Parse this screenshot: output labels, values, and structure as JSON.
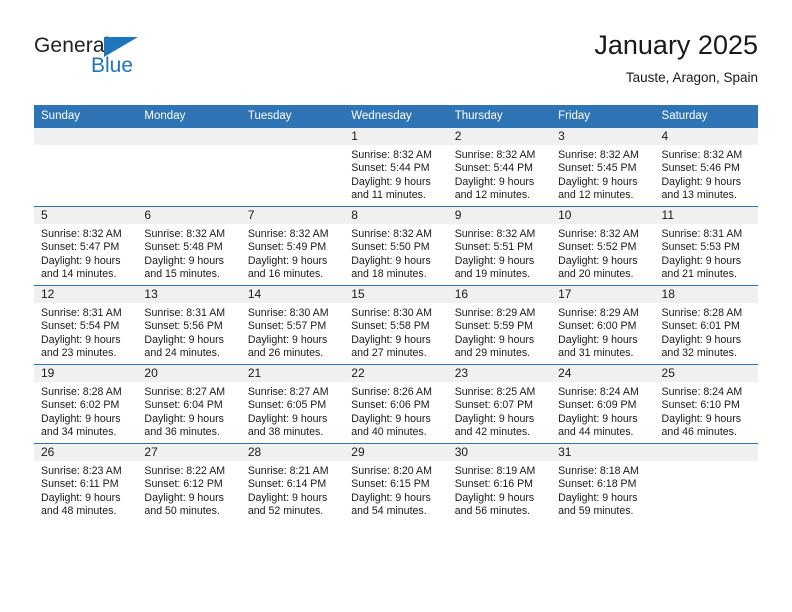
{
  "brand": {
    "line1": "General",
    "line2": "Blue",
    "triangle_color": "#1f76bc",
    "text_color": "#231f20"
  },
  "header": {
    "title": "January 2025",
    "subtitle": "Tauste, Aragon, Spain"
  },
  "theme": {
    "header_row_bg": "#2f74b5",
    "header_row_text": "#ffffff",
    "daynum_bg": "#f0f0f0",
    "grid_line": "#2f74b5",
    "cell_bg": "#ffffff"
  },
  "calendar": {
    "weekday_headers": [
      "Sunday",
      "Monday",
      "Tuesday",
      "Wednesday",
      "Thursday",
      "Friday",
      "Saturday"
    ],
    "weeks": [
      [
        {
          "day": "",
          "blank": true,
          "sunrise": "",
          "sunset": "",
          "daylight_line1": "",
          "daylight_line2": ""
        },
        {
          "day": "",
          "blank": true,
          "sunrise": "",
          "sunset": "",
          "daylight_line1": "",
          "daylight_line2": ""
        },
        {
          "day": "",
          "blank": true,
          "sunrise": "",
          "sunset": "",
          "daylight_line1": "",
          "daylight_line2": ""
        },
        {
          "day": "1",
          "blank": false,
          "sunrise": "Sunrise: 8:32 AM",
          "sunset": "Sunset: 5:44 PM",
          "daylight_line1": "Daylight: 9 hours",
          "daylight_line2": "and 11 minutes."
        },
        {
          "day": "2",
          "blank": false,
          "sunrise": "Sunrise: 8:32 AM",
          "sunset": "Sunset: 5:44 PM",
          "daylight_line1": "Daylight: 9 hours",
          "daylight_line2": "and 12 minutes."
        },
        {
          "day": "3",
          "blank": false,
          "sunrise": "Sunrise: 8:32 AM",
          "sunset": "Sunset: 5:45 PM",
          "daylight_line1": "Daylight: 9 hours",
          "daylight_line2": "and 12 minutes."
        },
        {
          "day": "4",
          "blank": false,
          "sunrise": "Sunrise: 8:32 AM",
          "sunset": "Sunset: 5:46 PM",
          "daylight_line1": "Daylight: 9 hours",
          "daylight_line2": "and 13 minutes."
        }
      ],
      [
        {
          "day": "5",
          "blank": false,
          "sunrise": "Sunrise: 8:32 AM",
          "sunset": "Sunset: 5:47 PM",
          "daylight_line1": "Daylight: 9 hours",
          "daylight_line2": "and 14 minutes."
        },
        {
          "day": "6",
          "blank": false,
          "sunrise": "Sunrise: 8:32 AM",
          "sunset": "Sunset: 5:48 PM",
          "daylight_line1": "Daylight: 9 hours",
          "daylight_line2": "and 15 minutes."
        },
        {
          "day": "7",
          "blank": false,
          "sunrise": "Sunrise: 8:32 AM",
          "sunset": "Sunset: 5:49 PM",
          "daylight_line1": "Daylight: 9 hours",
          "daylight_line2": "and 16 minutes."
        },
        {
          "day": "8",
          "blank": false,
          "sunrise": "Sunrise: 8:32 AM",
          "sunset": "Sunset: 5:50 PM",
          "daylight_line1": "Daylight: 9 hours",
          "daylight_line2": "and 18 minutes."
        },
        {
          "day": "9",
          "blank": false,
          "sunrise": "Sunrise: 8:32 AM",
          "sunset": "Sunset: 5:51 PM",
          "daylight_line1": "Daylight: 9 hours",
          "daylight_line2": "and 19 minutes."
        },
        {
          "day": "10",
          "blank": false,
          "sunrise": "Sunrise: 8:32 AM",
          "sunset": "Sunset: 5:52 PM",
          "daylight_line1": "Daylight: 9 hours",
          "daylight_line2": "and 20 minutes."
        },
        {
          "day": "11",
          "blank": false,
          "sunrise": "Sunrise: 8:31 AM",
          "sunset": "Sunset: 5:53 PM",
          "daylight_line1": "Daylight: 9 hours",
          "daylight_line2": "and 21 minutes."
        }
      ],
      [
        {
          "day": "12",
          "blank": false,
          "sunrise": "Sunrise: 8:31 AM",
          "sunset": "Sunset: 5:54 PM",
          "daylight_line1": "Daylight: 9 hours",
          "daylight_line2": "and 23 minutes."
        },
        {
          "day": "13",
          "blank": false,
          "sunrise": "Sunrise: 8:31 AM",
          "sunset": "Sunset: 5:56 PM",
          "daylight_line1": "Daylight: 9 hours",
          "daylight_line2": "and 24 minutes."
        },
        {
          "day": "14",
          "blank": false,
          "sunrise": "Sunrise: 8:30 AM",
          "sunset": "Sunset: 5:57 PM",
          "daylight_line1": "Daylight: 9 hours",
          "daylight_line2": "and 26 minutes."
        },
        {
          "day": "15",
          "blank": false,
          "sunrise": "Sunrise: 8:30 AM",
          "sunset": "Sunset: 5:58 PM",
          "daylight_line1": "Daylight: 9 hours",
          "daylight_line2": "and 27 minutes."
        },
        {
          "day": "16",
          "blank": false,
          "sunrise": "Sunrise: 8:29 AM",
          "sunset": "Sunset: 5:59 PM",
          "daylight_line1": "Daylight: 9 hours",
          "daylight_line2": "and 29 minutes."
        },
        {
          "day": "17",
          "blank": false,
          "sunrise": "Sunrise: 8:29 AM",
          "sunset": "Sunset: 6:00 PM",
          "daylight_line1": "Daylight: 9 hours",
          "daylight_line2": "and 31 minutes."
        },
        {
          "day": "18",
          "blank": false,
          "sunrise": "Sunrise: 8:28 AM",
          "sunset": "Sunset: 6:01 PM",
          "daylight_line1": "Daylight: 9 hours",
          "daylight_line2": "and 32 minutes."
        }
      ],
      [
        {
          "day": "19",
          "blank": false,
          "sunrise": "Sunrise: 8:28 AM",
          "sunset": "Sunset: 6:02 PM",
          "daylight_line1": "Daylight: 9 hours",
          "daylight_line2": "and 34 minutes."
        },
        {
          "day": "20",
          "blank": false,
          "sunrise": "Sunrise: 8:27 AM",
          "sunset": "Sunset: 6:04 PM",
          "daylight_line1": "Daylight: 9 hours",
          "daylight_line2": "and 36 minutes."
        },
        {
          "day": "21",
          "blank": false,
          "sunrise": "Sunrise: 8:27 AM",
          "sunset": "Sunset: 6:05 PM",
          "daylight_line1": "Daylight: 9 hours",
          "daylight_line2": "and 38 minutes."
        },
        {
          "day": "22",
          "blank": false,
          "sunrise": "Sunrise: 8:26 AM",
          "sunset": "Sunset: 6:06 PM",
          "daylight_line1": "Daylight: 9 hours",
          "daylight_line2": "and 40 minutes."
        },
        {
          "day": "23",
          "blank": false,
          "sunrise": "Sunrise: 8:25 AM",
          "sunset": "Sunset: 6:07 PM",
          "daylight_line1": "Daylight: 9 hours",
          "daylight_line2": "and 42 minutes."
        },
        {
          "day": "24",
          "blank": false,
          "sunrise": "Sunrise: 8:24 AM",
          "sunset": "Sunset: 6:09 PM",
          "daylight_line1": "Daylight: 9 hours",
          "daylight_line2": "and 44 minutes."
        },
        {
          "day": "25",
          "blank": false,
          "sunrise": "Sunrise: 8:24 AM",
          "sunset": "Sunset: 6:10 PM",
          "daylight_line1": "Daylight: 9 hours",
          "daylight_line2": "and 46 minutes."
        }
      ],
      [
        {
          "day": "26",
          "blank": false,
          "sunrise": "Sunrise: 8:23 AM",
          "sunset": "Sunset: 6:11 PM",
          "daylight_line1": "Daylight: 9 hours",
          "daylight_line2": "and 48 minutes."
        },
        {
          "day": "27",
          "blank": false,
          "sunrise": "Sunrise: 8:22 AM",
          "sunset": "Sunset: 6:12 PM",
          "daylight_line1": "Daylight: 9 hours",
          "daylight_line2": "and 50 minutes."
        },
        {
          "day": "28",
          "blank": false,
          "sunrise": "Sunrise: 8:21 AM",
          "sunset": "Sunset: 6:14 PM",
          "daylight_line1": "Daylight: 9 hours",
          "daylight_line2": "and 52 minutes."
        },
        {
          "day": "29",
          "blank": false,
          "sunrise": "Sunrise: 8:20 AM",
          "sunset": "Sunset: 6:15 PM",
          "daylight_line1": "Daylight: 9 hours",
          "daylight_line2": "and 54 minutes."
        },
        {
          "day": "30",
          "blank": false,
          "sunrise": "Sunrise: 8:19 AM",
          "sunset": "Sunset: 6:16 PM",
          "daylight_line1": "Daylight: 9 hours",
          "daylight_line2": "and 56 minutes."
        },
        {
          "day": "31",
          "blank": false,
          "sunrise": "Sunrise: 8:18 AM",
          "sunset": "Sunset: 6:18 PM",
          "daylight_line1": "Daylight: 9 hours",
          "daylight_line2": "and 59 minutes."
        },
        {
          "day": "",
          "blank": true,
          "sunrise": "",
          "sunset": "",
          "daylight_line1": "",
          "daylight_line2": ""
        }
      ]
    ]
  }
}
